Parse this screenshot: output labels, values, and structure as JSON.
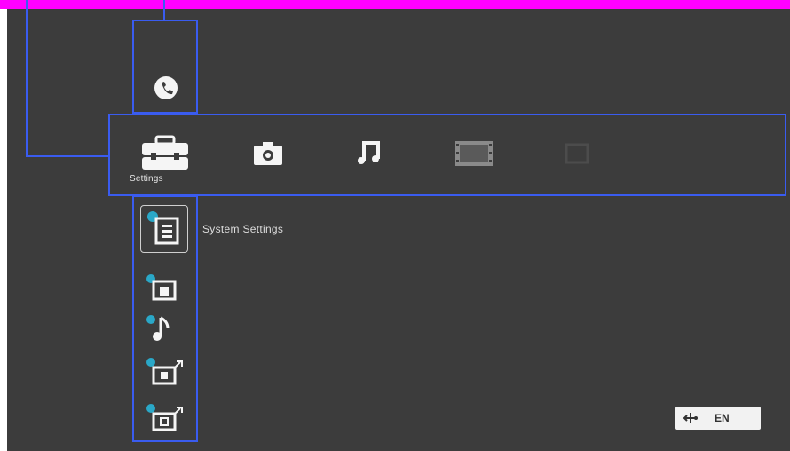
{
  "top_menu": {
    "items": [
      {
        "id": "settings",
        "label": "Settings",
        "icon": "toolbox-icon",
        "selected": true
      },
      {
        "id": "photo",
        "label": "",
        "icon": "camera-icon",
        "selected": false
      },
      {
        "id": "music",
        "label": "",
        "icon": "music-note-icon",
        "selected": false
      },
      {
        "id": "video",
        "label": "",
        "icon": "film-icon",
        "selected": false
      },
      {
        "id": "tv",
        "label": "",
        "icon": "tv-icon",
        "selected": false
      }
    ]
  },
  "side_menu": {
    "top_icon": "phone-icon",
    "items": [
      {
        "id": "system-settings",
        "label": "System Settings",
        "icon": "system-settings-icon",
        "selected": true
      },
      {
        "id": "photo-settings",
        "label": "",
        "icon": "photo-settings-icon",
        "selected": false
      },
      {
        "id": "music-settings",
        "label": "",
        "icon": "music-settings-icon",
        "selected": false
      },
      {
        "id": "video-settings",
        "label": "",
        "icon": "video-settings-icon",
        "selected": false
      },
      {
        "id": "tv-settings",
        "label": "",
        "icon": "tv-settings-icon",
        "selected": false
      }
    ]
  },
  "status": {
    "usb_icon": "usb-icon",
    "language": "EN"
  },
  "colors": {
    "highlight": "#3a5cf0",
    "background": "#3c3c3c",
    "top_bar": "#ff00ff"
  }
}
